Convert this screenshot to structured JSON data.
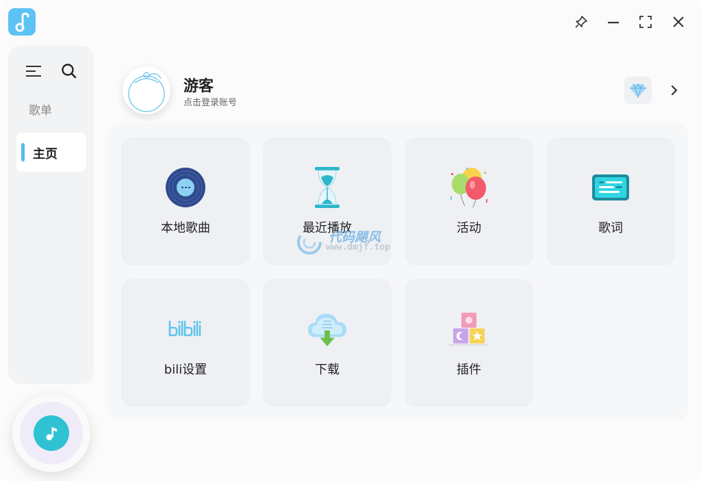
{
  "app": {
    "logo_icon": "music-note-icon",
    "accent": "#5cc3f4"
  },
  "titlebar": {
    "buttons": [
      "pin-icon",
      "minimize-icon",
      "maximize-icon",
      "close-icon"
    ]
  },
  "sidebar": {
    "section_label": "歌单",
    "items": [
      {
        "label": "主页",
        "active": true
      }
    ]
  },
  "profile": {
    "name": "游客",
    "subtitle": "点击登录账号"
  },
  "tiles": [
    {
      "label": "本地歌曲",
      "icon": "vinyl-record-icon"
    },
    {
      "label": "最近播放",
      "icon": "hourglass-icon"
    },
    {
      "label": "活动",
      "icon": "balloons-icon"
    },
    {
      "label": "歌词",
      "icon": "lyrics-card-icon"
    },
    {
      "label": "bili设置",
      "icon": "bilibili-logo-icon"
    },
    {
      "label": "下载",
      "icon": "cloud-download-icon"
    },
    {
      "label": "插件",
      "icon": "plugin-blocks-icon"
    }
  ],
  "watermark": {
    "title": "代码飓风",
    "url": "www.dmjf.top"
  },
  "player": {
    "icon": "music-note-icon"
  }
}
